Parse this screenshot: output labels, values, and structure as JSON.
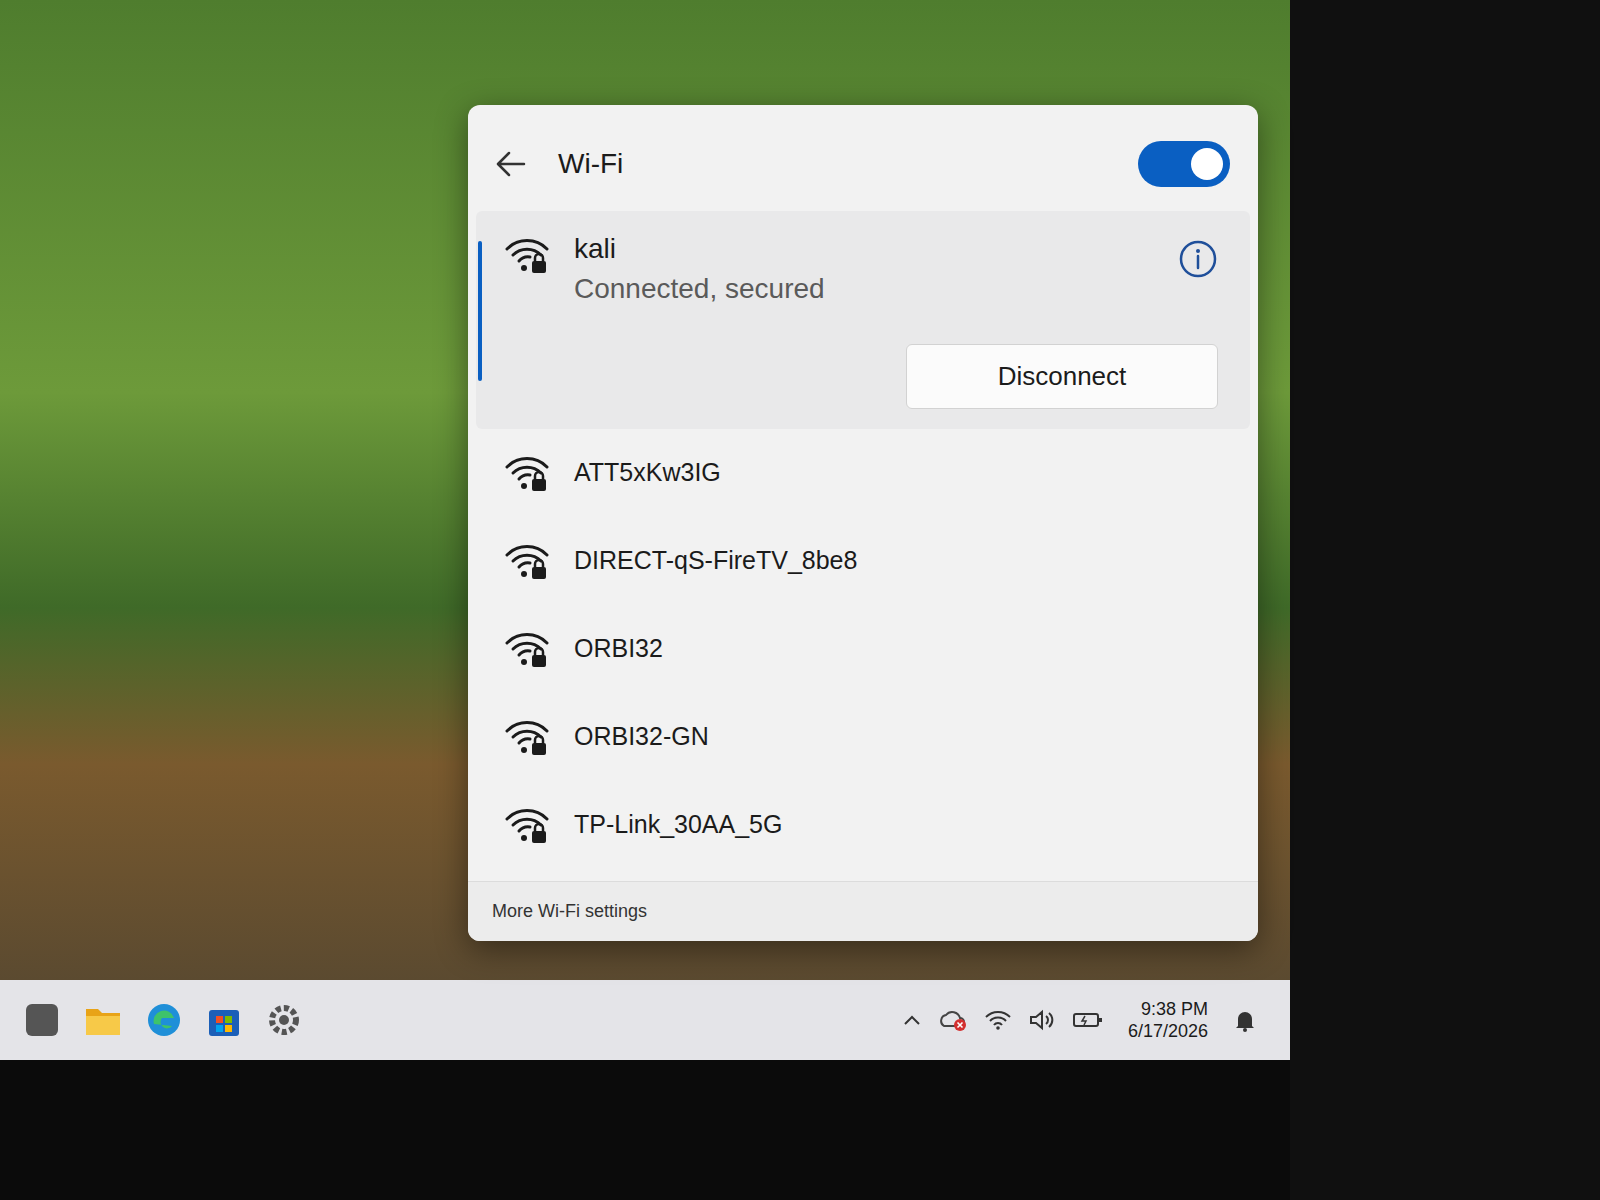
{
  "panel": {
    "title": "Wi-Fi",
    "wifi_on": true,
    "footer": "More Wi-Fi settings"
  },
  "networks": [
    {
      "ssid": "kali",
      "status": "Connected, secured",
      "button": "Disconnect",
      "connected": true
    },
    {
      "ssid": "ATT5xKw3IG",
      "connected": false
    },
    {
      "ssid": "DIRECT-qS-FireTV_8be8",
      "connected": false
    },
    {
      "ssid": "ORBI32",
      "connected": false
    },
    {
      "ssid": "ORBI32-GN",
      "connected": false
    },
    {
      "ssid": "TP-Link_30AA_5G",
      "connected": false
    }
  ],
  "taskbar": {
    "time": "9:38 PM",
    "date": "6/17/2026"
  }
}
